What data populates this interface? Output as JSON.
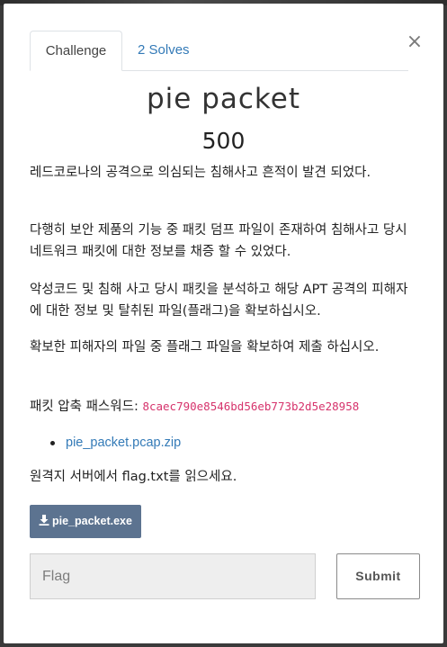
{
  "modal": {
    "close_symbol": "×"
  },
  "tabs": [
    {
      "label": "Challenge",
      "active": true
    },
    {
      "label": "2 Solves",
      "active": false
    }
  ],
  "challenge": {
    "title": "pie packet",
    "points": "500",
    "description": {
      "p1": "레드코로나의 공격으로 의심되는 침해사고 흔적이 발견 되었다.",
      "p2": "다행히 보안 제품의 기능 중 패킷 덤프 파일이 존재하여 침해사고 당시 네트워크 패킷에 대한 정보를 채증 할 수 있었다.",
      "p3": "악성코드 및 침해 사고 당시 패킷을 분석하고 해당 APT 공격의 피해자에 대한 정보 및 탈취된 파일(플래그)을 확보하십시오.",
      "p4": "확보한 피해자의 파일 중 플래그 파일을 확보하여 제출 하십시오.",
      "password_label": "패킷 압축 패스워드: ",
      "password_value": "8caec790e8546bd56eb773b2d5e28958",
      "files": [
        "pie_packet.pcap.zip"
      ],
      "p6": "원격지 서버에서 flag.txt를 읽으세요."
    },
    "download_label": "pie_packet.exe",
    "download_icon": "download-icon"
  },
  "form": {
    "flag_placeholder": "Flag",
    "flag_value": "",
    "submit_label": "Submit"
  },
  "colors": {
    "link": "#337ab7",
    "code": "#d6336c",
    "download_button": "#5c7390",
    "input_background": "#eeeeee"
  }
}
